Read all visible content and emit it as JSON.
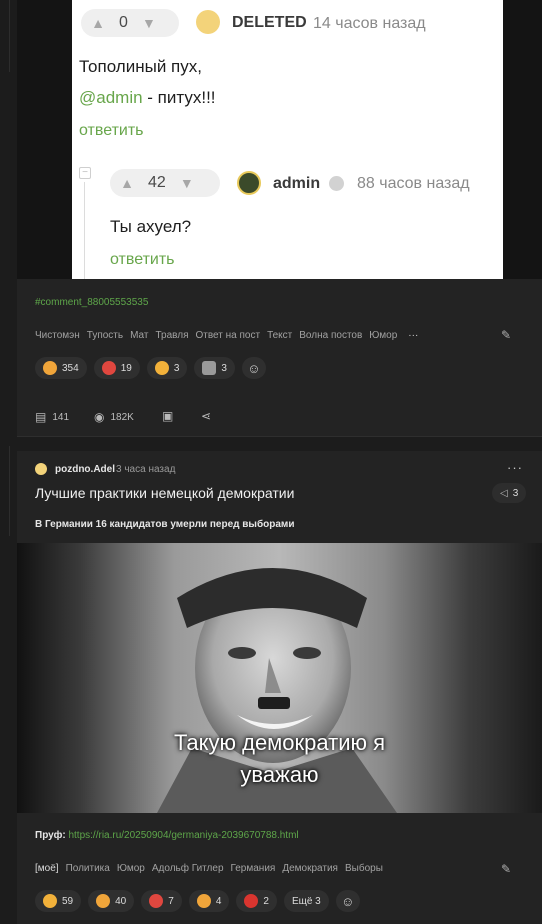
{
  "comment_shot": {
    "top": {
      "score": "0",
      "author": "DELETED",
      "time": "14 часов назад",
      "line1": "Тополиный пух,",
      "mention": "@admin",
      "line2_rest": " - питух!!!",
      "reply": "ответить"
    },
    "nested": {
      "score": "42",
      "author": "admin",
      "time": "88 часов назад",
      "text": "Ты ахуел?",
      "reply": "ответить"
    }
  },
  "post1": {
    "comment_link": "#comment_88005553535",
    "tags": [
      "Чистомэн",
      "Тупость",
      "Мат",
      "Травля",
      "Ответ на пост",
      "Текст",
      "Волна постов",
      "Юмор"
    ],
    "more_tags": "···",
    "reactions": [
      {
        "icon": "laughing-emoji-icon",
        "count": "354",
        "color": "#f0a53a"
      },
      {
        "icon": "devil-emoji-icon",
        "count": "19",
        "color": "#e0473f"
      },
      {
        "icon": "thinking-emoji-icon",
        "count": "3",
        "color": "#f2b13a"
      },
      {
        "icon": "moai-emoji-icon",
        "count": "3",
        "color": "#9a9a9a"
      }
    ],
    "comments": "141",
    "views": "182K"
  },
  "post2": {
    "author": "pozdno.Adel",
    "time": "3 часа назад",
    "title": "Лучшие практики немецкой демократии",
    "boost_count": "3",
    "subtitle": "В Германии 16 кандидатов умерли перед выборами",
    "image_caption_line1": "Такую демократию я",
    "image_caption_line2": "уважаю",
    "proof_label": "Пруф:",
    "proof_url": "https://ria.ru/20250904/germaniya-2039670788.html",
    "tags": [
      "[моё]",
      "Политика",
      "Юмор",
      "Адольф Гитлер",
      "Германия",
      "Демократия",
      "Выборы"
    ],
    "reactions": [
      {
        "icon": "thinking-emoji-icon",
        "count": "59",
        "color": "#f2b13a"
      },
      {
        "icon": "laughing-emoji-icon",
        "count": "40",
        "color": "#f0a53a"
      },
      {
        "icon": "devil-emoji-icon",
        "count": "7",
        "color": "#e0473f"
      },
      {
        "icon": "sad-emoji-icon",
        "count": "4",
        "color": "#f0a53a"
      },
      {
        "icon": "angry-emoji-icon",
        "count": "2",
        "color": "#d9352f"
      }
    ],
    "more_reactions": "Ещё 3"
  }
}
